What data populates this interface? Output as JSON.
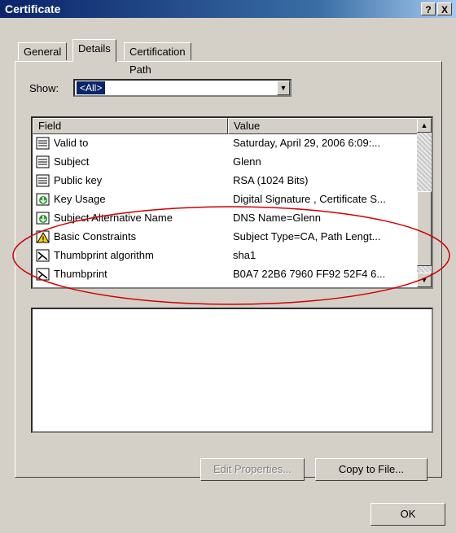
{
  "window": {
    "title": "Certificate",
    "help_label": "?",
    "close_label": "X"
  },
  "tabs": [
    {
      "label": "General"
    },
    {
      "label": "Details"
    },
    {
      "label": "Certification Path"
    }
  ],
  "show": {
    "label": "Show:",
    "value": "<All>"
  },
  "list": {
    "columns": [
      "Field",
      "Value"
    ],
    "rows": [
      {
        "field": "Valid to",
        "value": "Saturday, April 29, 2006 6:09:...",
        "icon": "document-icon"
      },
      {
        "field": "Subject",
        "value": "Glenn",
        "icon": "document-icon"
      },
      {
        "field": "Public key",
        "value": "RSA (1024 Bits)",
        "icon": "document-icon"
      },
      {
        "field": "Key Usage",
        "value": "Digital Signature , Certificate S...",
        "icon": "extension-icon"
      },
      {
        "field": "Subject Alternative Name",
        "value": "DNS Name=Glenn",
        "icon": "extension-icon"
      },
      {
        "field": "Basic Constraints",
        "value": "Subject Type=CA, Path Lengt...",
        "icon": "critical-extension-icon"
      },
      {
        "field": "Thumbprint algorithm",
        "value": "sha1",
        "icon": "property-icon"
      },
      {
        "field": "Thumbprint",
        "value": "B0A7 22B6 7960 FF92 52F4 6...",
        "icon": "property-icon"
      }
    ]
  },
  "buttons": {
    "edit_properties": "Edit Properties...",
    "copy_to_file": "Copy to File...",
    "ok": "OK"
  },
  "colors": {
    "titlebar": "#0a246a",
    "face": "#d4d0c8",
    "annotation": "#d00000"
  }
}
